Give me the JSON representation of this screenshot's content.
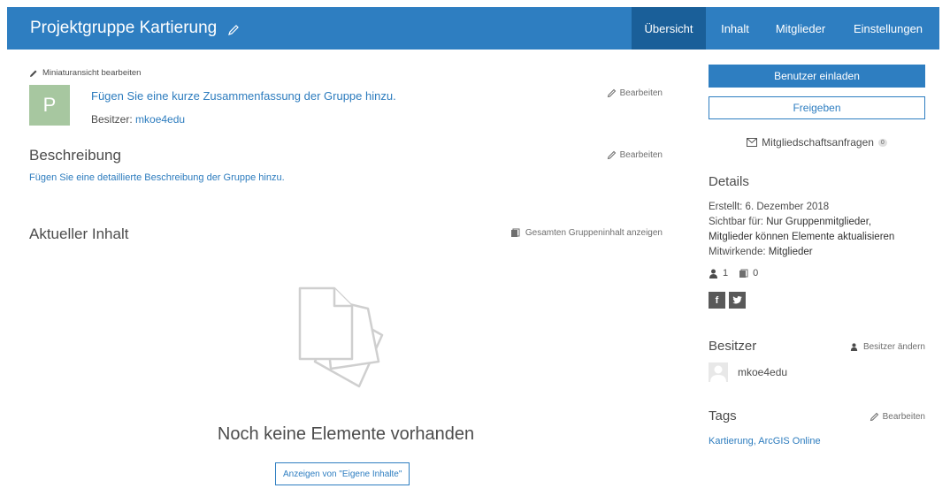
{
  "header": {
    "title": "Projektgruppe Kartierung",
    "tabs": [
      {
        "label": "Übersicht",
        "active": true
      },
      {
        "label": "Inhalt",
        "active": false
      },
      {
        "label": "Mitglieder",
        "active": false
      },
      {
        "label": "Einstellungen",
        "active": false
      }
    ]
  },
  "overview": {
    "thumbnail_edit": "Miniaturansicht bearbeiten",
    "thumbnail_letter": "P",
    "summary_link": "Fügen Sie eine kurze Zusammenfassung der Gruppe hinzu.",
    "owner_label": "Besitzer:",
    "owner_name": "mkoe4edu",
    "edit_label": "Bearbeiten",
    "description_heading": "Beschreibung",
    "description_link": "Fügen Sie eine detaillierte Beschreibung der Gruppe hinzu.",
    "current_heading": "Aktueller Inhalt",
    "show_all": "Gesamten Gruppeninhalt anzeigen",
    "empty_text": "Noch keine Elemente vorhanden",
    "my_content_button": "Anzeigen von \"Eigene Inhalte\""
  },
  "sidebar": {
    "invite_button": "Benutzer einladen",
    "share_button": "Freigeben",
    "requests_label": "Mitgliedschaftsanfragen",
    "requests_count": "0",
    "details_heading": "Details",
    "created_label": "Erstellt:",
    "created_value": "6. Dezember 2018",
    "visible_label": "Sichtbar für:",
    "visible_value": "Nur Gruppenmitglieder,",
    "update_value": "Mitglieder können Elemente aktualisieren",
    "contributors_label": "Mitwirkende:",
    "contributors_value": "Mitglieder",
    "member_count": "1",
    "item_count": "0",
    "social_facebook": "f",
    "owner_heading": "Besitzer",
    "change_owner": "Besitzer ändern",
    "owner_name": "mkoe4edu",
    "tags_heading": "Tags",
    "tags_edit": "Bearbeiten",
    "tags_value": "Kartierung, ArcGIS Online"
  },
  "colors": {
    "brand": "#2e7ec1",
    "brand_dark": "#1a5f99",
    "thumbnail": "#a7c7a0"
  },
  "icons": [
    "pencil-icon",
    "envelope-icon",
    "user-icon",
    "items-icon",
    "facebook-icon",
    "twitter-icon",
    "empty-documents-icon"
  ]
}
